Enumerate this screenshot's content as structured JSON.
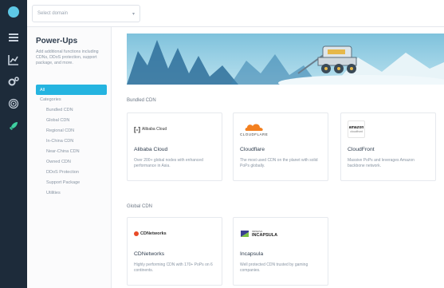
{
  "topbar": {
    "domain_placeholder": "Select domain"
  },
  "subnav": {
    "title": "Power-Ups",
    "description": "Add additional functions including CDNs, DDoS protection, support package, and more.",
    "all_label": "All",
    "categories_label": "Categories",
    "categories": [
      "Bundled CDN",
      "Global CDN",
      "Regional CDN",
      "In-China CDN",
      "Near-China CDN",
      "Owned CDN",
      "DDoS Protection",
      "Support Package",
      "Utilities"
    ]
  },
  "main": {
    "sections": [
      {
        "title": "Bundled CDN",
        "cards": [
          {
            "name": "Alibaba Cloud",
            "description": "Over 200+ global nodes with enhanced performance in Asia.",
            "logo_text": "Alibaba Cloud"
          },
          {
            "name": "Cloudflare",
            "description": "The most used CDN on the planet with solid PoPs globally.",
            "logo_text": "CLOUDFLARE"
          },
          {
            "name": "CloudFront",
            "description": "Massive PoPs and leverages Amazon backbone network.",
            "logo_text_1": "amazon",
            "logo_text_2": "cloudfront"
          }
        ]
      },
      {
        "title": "Global CDN",
        "cards": [
          {
            "name": "CDNetworks",
            "description": "Highly performing CDN with 170+ PoPs on 6 continents.",
            "logo_text": "CDNetworks"
          },
          {
            "name": "Incapsula",
            "description": "Well protected CDN trusted by gaming companies.",
            "logo_text_1": "IMPERVA",
            "logo_text_2": "INCAPSULA"
          }
        ]
      }
    ]
  },
  "colors": {
    "rail_bg": "#1d2b3a",
    "accent": "#25b4e0",
    "cloudflare_orange": "#f38020",
    "banner_sky": "#8fcbe0"
  },
  "icons": [
    "logo-icon",
    "list-icon",
    "chart-icon",
    "gears-icon",
    "fingerprint-icon",
    "rocket-icon",
    "chevron-down-icon"
  ]
}
